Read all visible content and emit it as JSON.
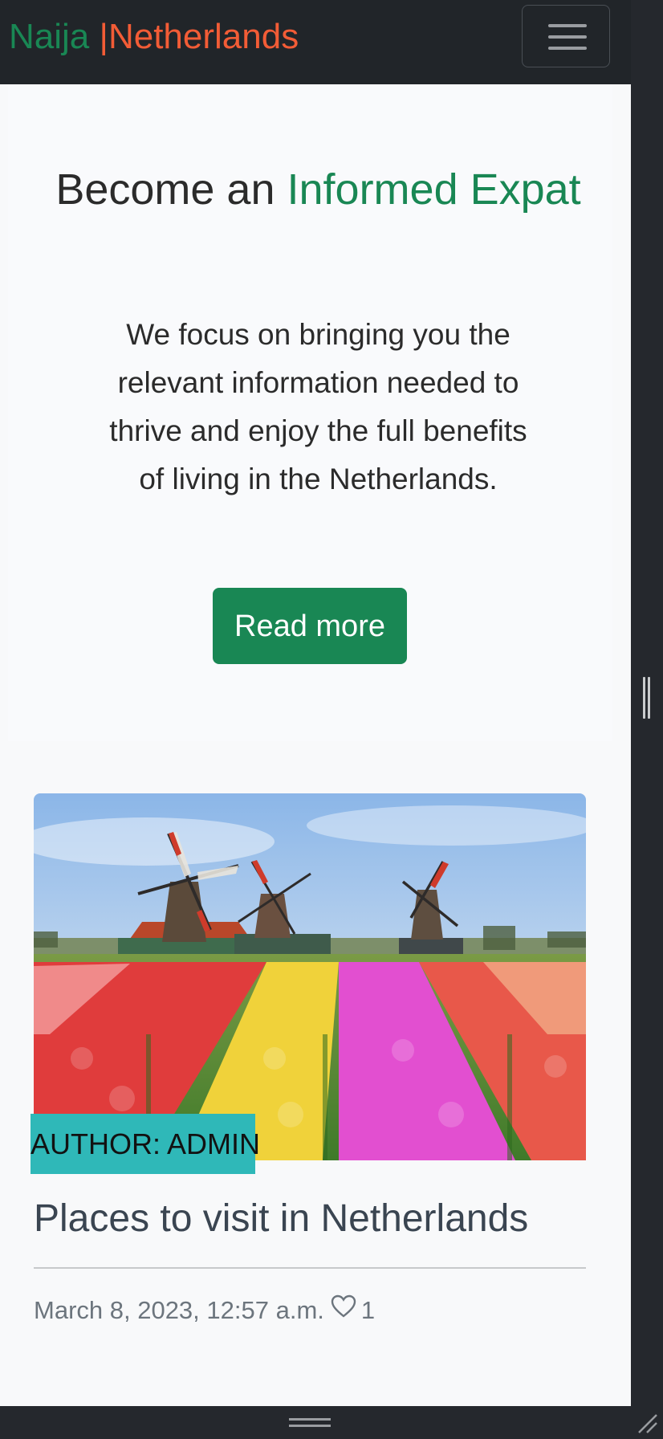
{
  "brand": {
    "part1": "Naija",
    "separator": "|",
    "part2": "Netherlands"
  },
  "nav": {
    "toggler_icon": "hamburger-menu-icon"
  },
  "hero": {
    "title_prefix": "Become an",
    "title_accent": "Informed Expat",
    "description": "We focus on bringing you the relevant information needed to thrive and enjoy the full benefits of living in the Netherlands.",
    "button_label": "Read more"
  },
  "post": {
    "image_icon": "windmills-tulip-field-image",
    "author_badge": "AUTHOR: ADMIN",
    "title": "Places to visit in Netherlands",
    "date": "March 8, 2023, 12:57 a.m.",
    "like_icon": "heart-icon",
    "likes": "1"
  },
  "colors": {
    "brand_green": "#198754",
    "brand_orange": "#f25c36",
    "badge_teal": "#2fb8b8",
    "navbar": "#212529"
  }
}
